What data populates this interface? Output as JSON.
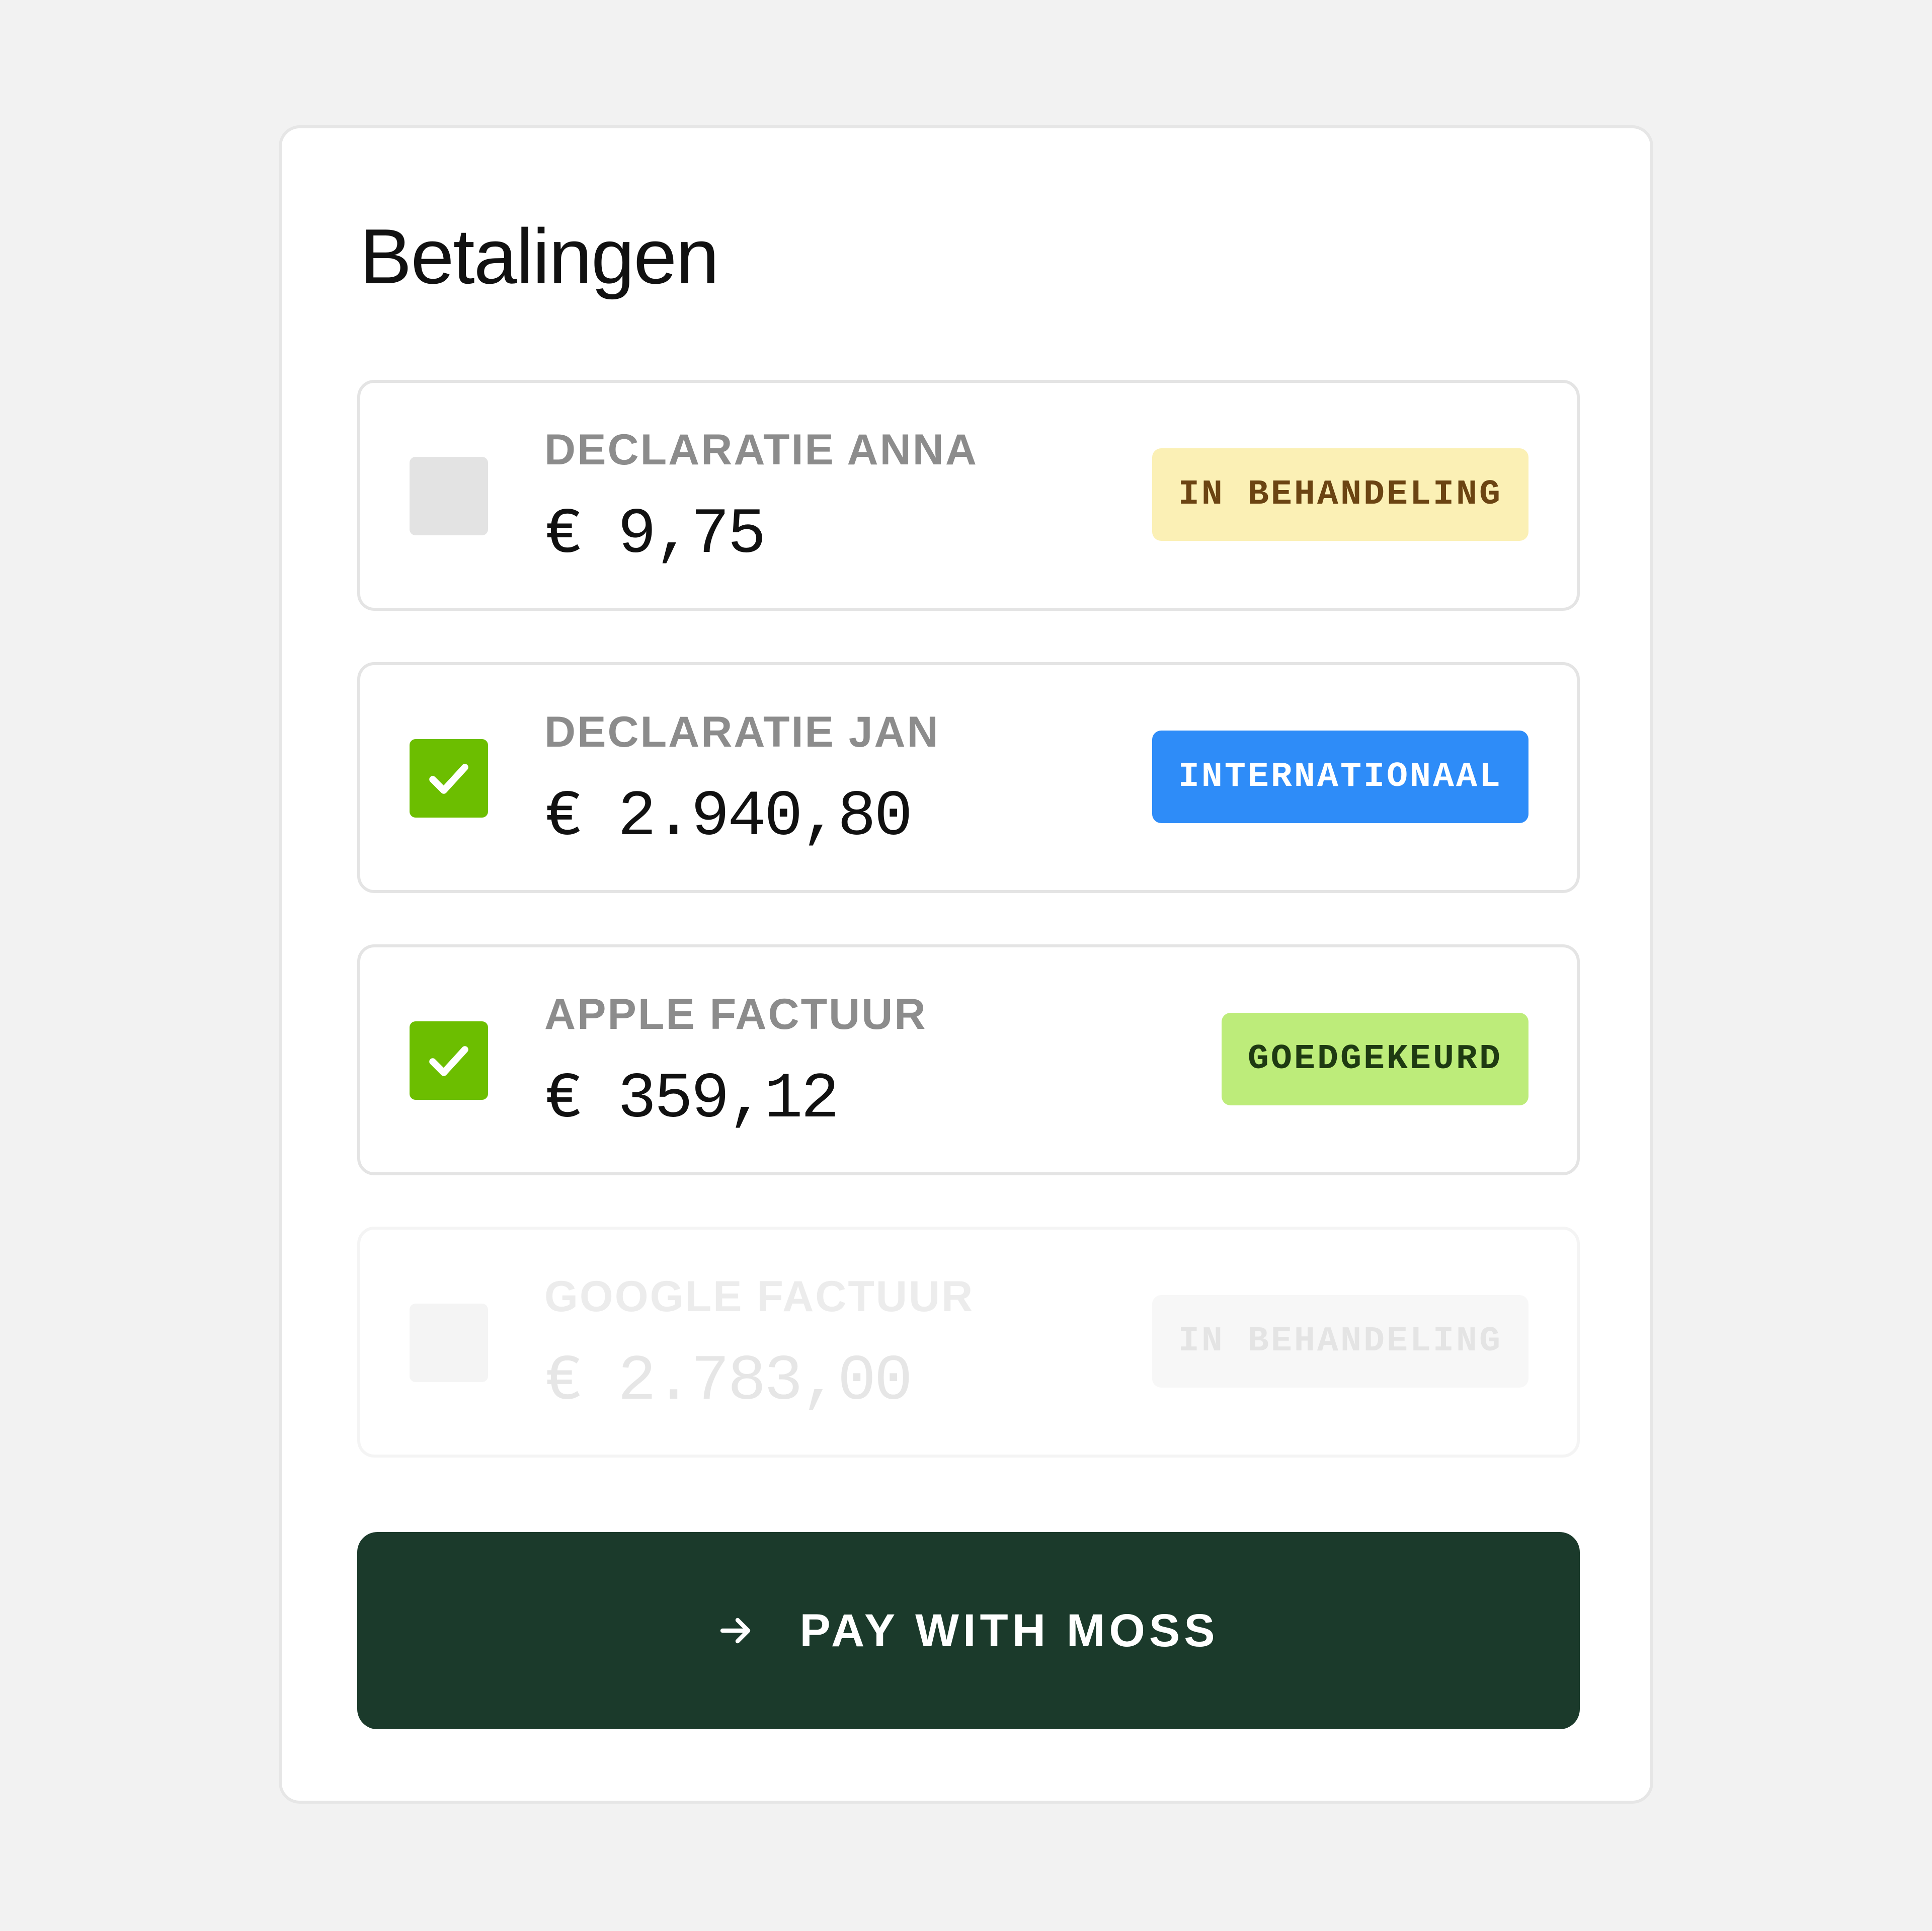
{
  "panel": {
    "title": "Betalingen"
  },
  "payments": [
    {
      "label": "DECLARATIE ANNA",
      "amount": "€ 9,75",
      "checked": false,
      "status": "IN BEHANDELING",
      "status_bg": "#fbf0b5",
      "status_fg": "#6b4412",
      "faded": false
    },
    {
      "label": "DECLARATIE JAN",
      "amount": "€ 2.940,80",
      "checked": true,
      "status": "INTERNATIONAAL",
      "status_bg": "#2e8cf8",
      "status_fg": "#ffffff",
      "faded": false
    },
    {
      "label": "APPLE FACTUUR",
      "amount": "€ 359,12",
      "checked": true,
      "status": "GOEDGEKEURD",
      "status_bg": "#bdec7a",
      "status_fg": "#1e3a12",
      "faded": false
    },
    {
      "label": "GOOGLE FACTUUR",
      "amount": "€ 2.783,00",
      "checked": false,
      "status": "IN BEHANDELING",
      "status_bg": "#f7f7f7",
      "status_fg": "#e4e4e4",
      "faded": true
    }
  ],
  "pay_button": {
    "label": "PAY WITH MOSS",
    "icon": "arrow-right-icon"
  },
  "colors": {
    "check_green": "#6cbe00",
    "button_dark_green": "#1b3a2b",
    "page_background": "#f2f2f2"
  }
}
